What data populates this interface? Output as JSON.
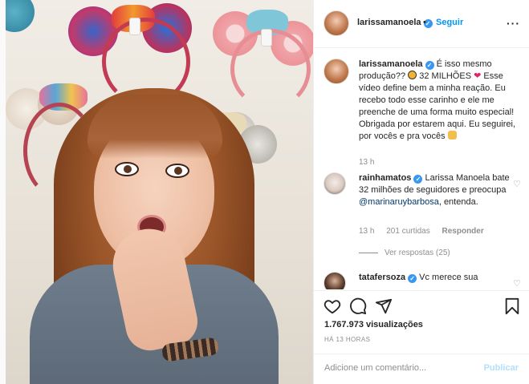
{
  "post": {
    "author": "larissamanoela",
    "follow_label": "Seguir",
    "separator": "•",
    "more_label": "···",
    "verified_mark": "✓"
  },
  "comments": [
    {
      "user": "larissamanoela",
      "text_a": "É isso mesmo produção??",
      "text_b": "32 MILHÕES",
      "text_c": "Esse vídeo define bem a minha reação. Eu recebo todo esse carinho e ele me preenche de uma forma muito especial! Obrigada por estarem aqui. Eu seguirei, por vocês e pra vocês",
      "time": "13 h"
    },
    {
      "user": "rainhamatos",
      "text": "Larissa Manoela bate 32 milhões de seguidores e preocupa",
      "mention": "@marinaruybarbosa",
      "text_end": ", entenda.",
      "time": "13 h",
      "likes": "201 curtidas",
      "reply": "Responder",
      "view_replies": "Ver respostas (25)"
    },
    {
      "user": "tatafersoza",
      "text": "Vc merece sua"
    }
  ],
  "stats": {
    "views": "1.767.973 visualizações",
    "posted": "HÁ 13 HORAS"
  },
  "composer": {
    "placeholder": "Adicione um comentário...",
    "publish": "Publicar"
  },
  "icons": {
    "like": "heart-icon",
    "comment": "comment-icon",
    "share": "share-icon",
    "save": "bookmark-icon"
  },
  "colors": {
    "accent": "#0095f6",
    "verified": "#3897f0",
    "muted": "#8e8e8e",
    "publish_disabled": "#b2dffc"
  }
}
